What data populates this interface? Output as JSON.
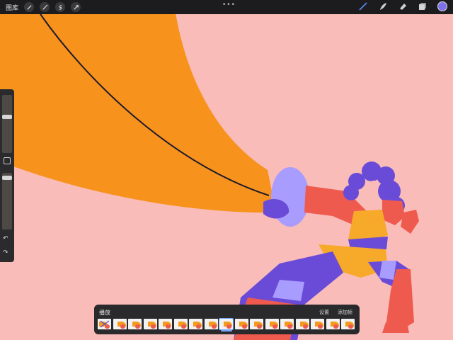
{
  "topbar": {
    "gallery_label": "图库",
    "left_tools": [
      "wrench-icon",
      "magic-wand-icon",
      "selection-icon",
      "transform-arrow-icon"
    ],
    "menu_dots": "•••",
    "right_tools": [
      "brush-icon",
      "smudge-icon",
      "eraser-icon",
      "layers-icon"
    ],
    "current_color": "#7e71e8"
  },
  "sidebar": {
    "brush_size_level": 0.3,
    "opacity_level": 0.05,
    "undo_glyph": "↶",
    "redo_glyph": "↷"
  },
  "timeline": {
    "play_label": "播放",
    "settings_label": "设置",
    "add_frame_label": "添加帧",
    "frame_count": 17,
    "current_frame": 9
  },
  "colors": {
    "background": "#f9bcb8",
    "orange": "#f7931c",
    "purple": "#6a4bd8",
    "lavender": "#a89cff",
    "skin": "#ef5a4f",
    "yellow": "#f7a92a"
  }
}
